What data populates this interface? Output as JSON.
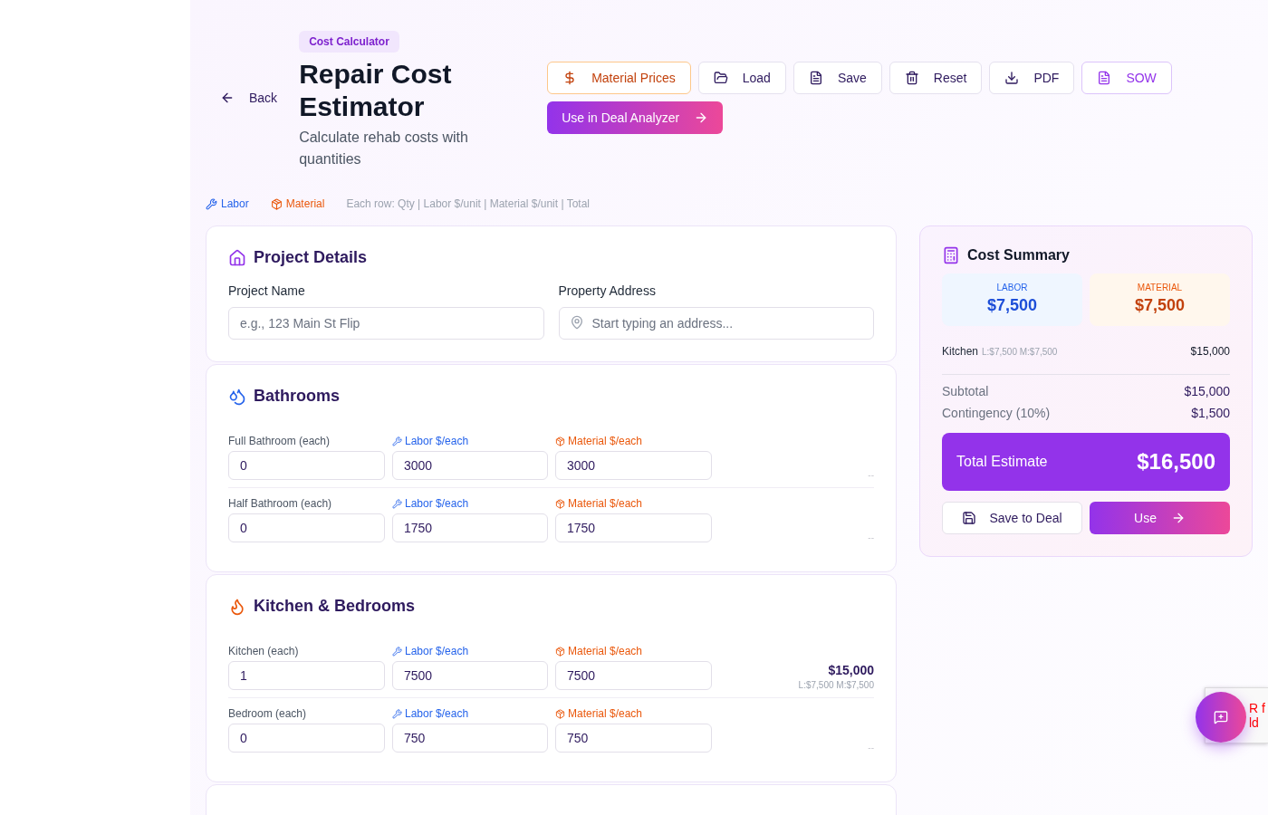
{
  "header": {
    "back": "Back",
    "badge": "Cost Calculator",
    "title": "Repair Cost Estimator",
    "subtitle": "Calculate rehab costs with quantities"
  },
  "toolbar": [
    {
      "label": "Material Prices",
      "kind": "prices"
    },
    {
      "label": "Load",
      "kind": "load"
    },
    {
      "label": "Save",
      "kind": "save"
    },
    {
      "label": "Reset",
      "kind": "reset"
    },
    {
      "label": "PDF",
      "kind": "pdf"
    },
    {
      "label": "SOW",
      "kind": "sow"
    }
  ],
  "primary_action": "Use in Deal Analyzer",
  "legend": {
    "labor": "Labor",
    "material": "Material",
    "hint": "Each row: Qty | Labor $/unit | Material $/unit | Total"
  },
  "project": {
    "title": "Project Details",
    "fields": [
      {
        "label": "Project Name",
        "placeholder": "e.g., 123 Main St Flip",
        "kind": "text"
      },
      {
        "label": "Property Address",
        "placeholder": "Start typing an address...",
        "kind": "address"
      }
    ]
  },
  "sections": [
    {
      "title": "Bathrooms",
      "kind": "bath",
      "rows": [
        {
          "label": "Full Bathroom (each)",
          "qty": "0",
          "labor_label": "Labor $/each",
          "labor": "3000",
          "material_label": "Material $/each",
          "material": "3000",
          "total": "--"
        },
        {
          "label": "Half Bathroom (each)",
          "qty": "0",
          "labor_label": "Labor $/each",
          "labor": "1750",
          "material_label": "Material $/each",
          "material": "1750",
          "total": "--"
        }
      ]
    },
    {
      "title": "Kitchen & Bedrooms",
      "kind": "kitchen",
      "rows": [
        {
          "label": "Kitchen (each)",
          "qty": "1",
          "labor_label": "Labor $/each",
          "labor": "7500",
          "material_label": "Material $/each",
          "material": "7500",
          "total": "$15,000",
          "breakdown": "L:$7,500 M:$7,500"
        },
        {
          "label": "Bedroom (each)",
          "qty": "0",
          "labor_label": "Labor $/each",
          "labor": "750",
          "material_label": "Material $/each",
          "material": "750",
          "total": "--"
        }
      ]
    }
  ],
  "summary": {
    "title": "Cost Summary",
    "labor_label": "LABOR",
    "labor": "$7,500",
    "material_label": "MATERIAL",
    "material": "$7,500",
    "items": [
      {
        "name": "Kitchen",
        "breakdown": "L:$7,500 M:$7,500",
        "total": "$15,000"
      }
    ],
    "subtotal_label": "Subtotal",
    "subtotal": "$15,000",
    "contingency_label": "Contingency (10%)",
    "contingency": "$1,500",
    "total_label": "Total Estimate",
    "total": "$16,500",
    "save": "Save to Deal",
    "use": "Use"
  },
  "popup": [
    "R f",
    "ld"
  ]
}
